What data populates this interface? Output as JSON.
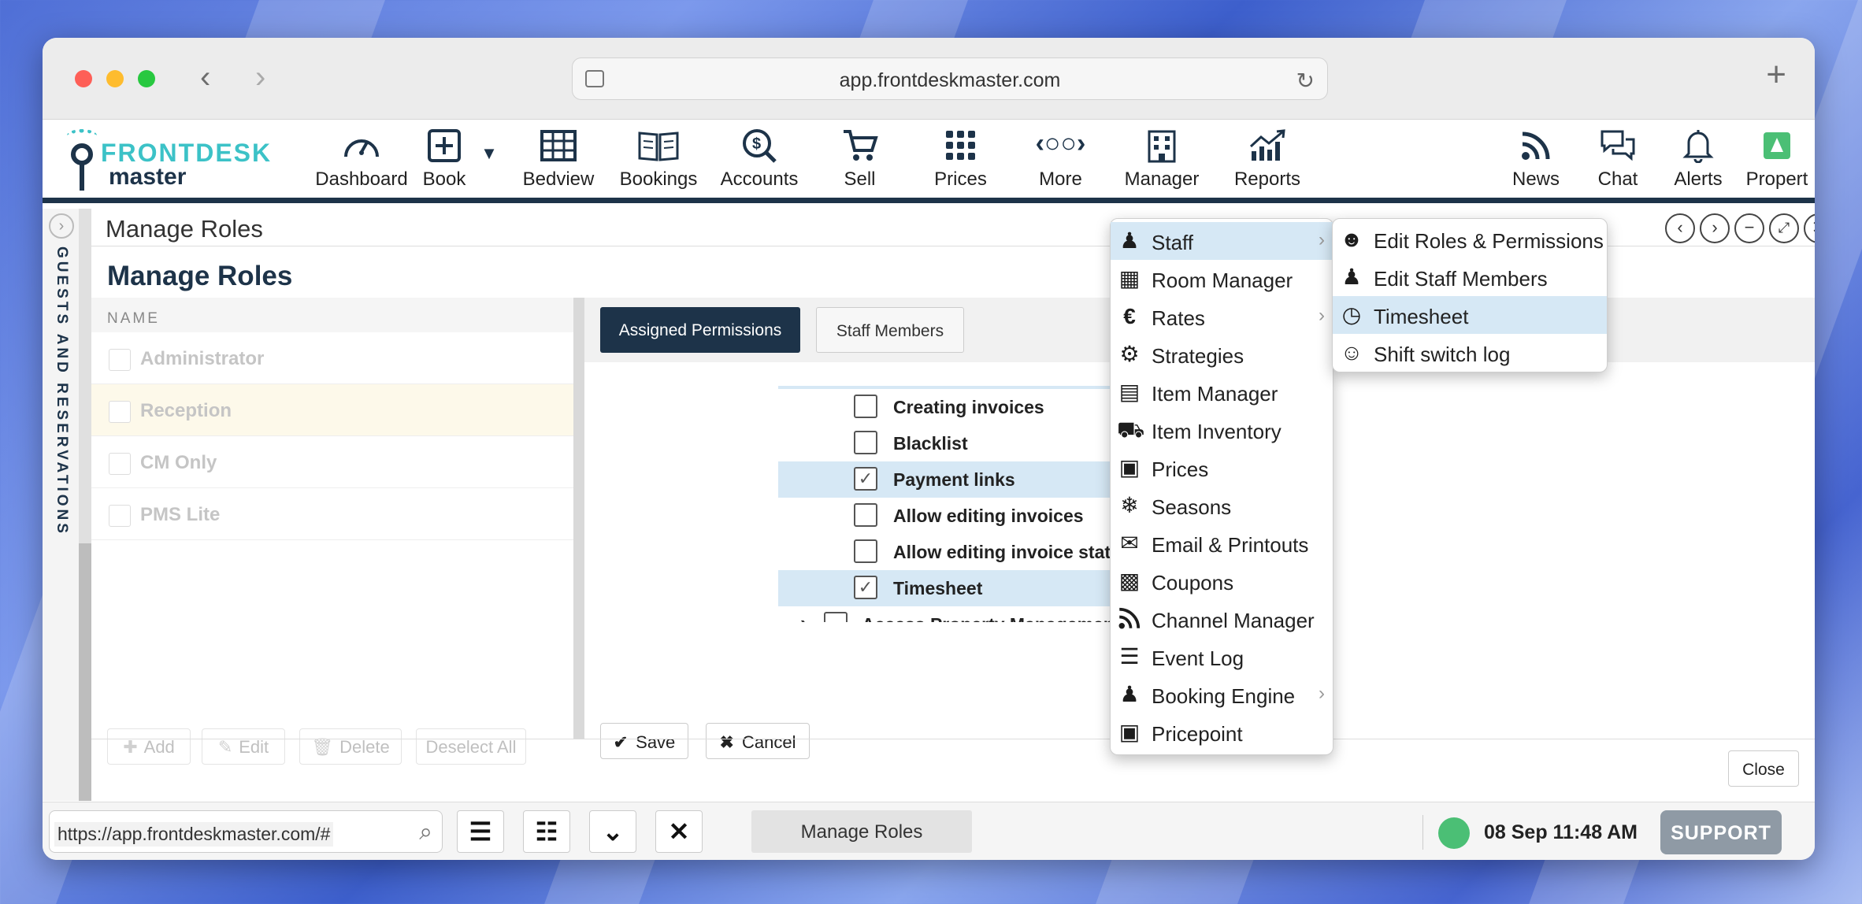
{
  "browser": {
    "url": "app.frontdeskmaster.com"
  },
  "logo": {
    "line1": "FRONTDESK",
    "line2": "master"
  },
  "nav": {
    "items": [
      {
        "label": "Dashboard",
        "icon": "speedometer-icon"
      },
      {
        "label": "Book",
        "icon": "plus-square-icon"
      },
      {
        "label": "Bedview",
        "icon": "grid-table-icon"
      },
      {
        "label": "Bookings",
        "icon": "open-book-icon"
      },
      {
        "label": "Accounts",
        "icon": "coin-search-icon"
      },
      {
        "label": "Sell",
        "icon": "cart-icon"
      },
      {
        "label": "Prices",
        "icon": "dots-grid-icon"
      },
      {
        "label": "More",
        "icon": "more-dots-icon"
      },
      {
        "label": "Manager",
        "icon": "building-icon"
      },
      {
        "label": "Reports",
        "icon": "chart-up-icon"
      },
      {
        "label": "News",
        "icon": "rss-icon"
      },
      {
        "label": "Chat",
        "icon": "chat-icon"
      },
      {
        "label": "Alerts",
        "icon": "bell-icon"
      },
      {
        "label": "Propert",
        "icon": "property-icon"
      }
    ]
  },
  "sidetab": {
    "label": "GUESTS AND RESERVATIONS"
  },
  "panel": {
    "header_title": "Manage Roles",
    "heading": "Manage Roles",
    "roles_column": "NAME",
    "roles": [
      "Administrator",
      "Reception",
      "CM Only",
      "PMS Lite"
    ],
    "role_actions": [
      "Add",
      "Edit",
      "Delete",
      "Deselect All"
    ],
    "tabs": [
      "Assigned Permissions",
      "Staff Members"
    ],
    "permissions": [
      {
        "label": "Creating invoices",
        "checked": false
      },
      {
        "label": "Blacklist",
        "checked": false
      },
      {
        "label": "Payment links",
        "checked": true
      },
      {
        "label": "Allow editing invoices",
        "checked": false
      },
      {
        "label": "Allow editing invoice status",
        "checked": false
      },
      {
        "label": "Timesheet",
        "checked": true
      },
      {
        "label": "Access Property Management feat",
        "checked": false
      }
    ],
    "save_label": "Save",
    "cancel_label": "Cancel",
    "close_label": "Close"
  },
  "manager_menu": [
    {
      "label": "Staff",
      "icon": "staff-icon",
      "submenu": true
    },
    {
      "label": "Room Manager",
      "icon": "building-icon",
      "submenu": false
    },
    {
      "label": "Rates",
      "icon": "euro-icon",
      "submenu": true
    },
    {
      "label": "Strategies",
      "icon": "strategies-icon",
      "submenu": false
    },
    {
      "label": "Item Manager",
      "icon": "basket-icon",
      "submenu": false
    },
    {
      "label": "Item Inventory",
      "icon": "cart-icon",
      "submenu": false
    },
    {
      "label": "Prices",
      "icon": "presentation-icon",
      "submenu": false
    },
    {
      "label": "Seasons",
      "icon": "seasons-icon",
      "submenu": false
    },
    {
      "label": "Email & Printouts",
      "icon": "envelope-icon",
      "submenu": false
    },
    {
      "label": "Coupons",
      "icon": "coupon-icon",
      "submenu": false
    },
    {
      "label": "Channel Manager",
      "icon": "rss-icon",
      "submenu": false
    },
    {
      "label": "Event Log",
      "icon": "list-icon",
      "submenu": false
    },
    {
      "label": "Booking Engine",
      "icon": "staff-icon",
      "submenu": true
    },
    {
      "label": "Pricepoint",
      "icon": "pricepoint-icon",
      "submenu": false
    }
  ],
  "staff_submenu": [
    {
      "label": "Edit Roles & Permissions",
      "icon": "user-lock-icon"
    },
    {
      "label": "Edit Staff Members",
      "icon": "staff-icon"
    },
    {
      "label": "Timesheet",
      "icon": "clock-icon"
    },
    {
      "label": "Shift switch log",
      "icon": "shift-switch-icon"
    }
  ],
  "bottombar": {
    "status_url": "https://app.frontdeskmaster.com/#",
    "task": "Manage Roles",
    "datetime": "08 Sep 11:48 AM",
    "support": "SUPPORT"
  }
}
